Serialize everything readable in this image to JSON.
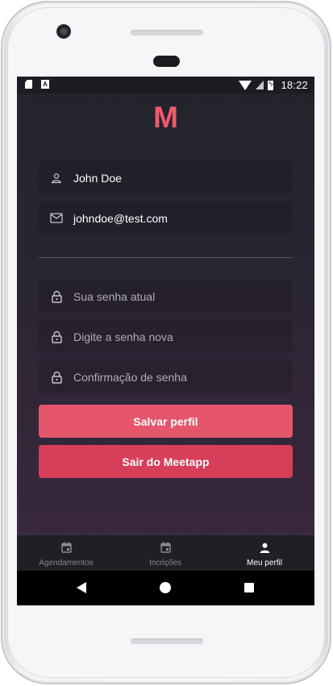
{
  "status_bar": {
    "time": "18:22",
    "notif_letter": "A"
  },
  "app": {
    "logo": "M",
    "brand_color": "#f15a6d"
  },
  "profile_form": {
    "name": {
      "value": "John Doe",
      "icon": "user-icon"
    },
    "email": {
      "value": "johndoe@test.com",
      "icon": "mail-icon"
    },
    "old_password": {
      "placeholder": "Sua senha atual",
      "icon": "lock-icon"
    },
    "new_password": {
      "placeholder": "Digite a senha nova",
      "icon": "lock-icon"
    },
    "confirm_password": {
      "placeholder": "Confirmação de senha",
      "icon": "lock-icon"
    }
  },
  "buttons": {
    "save": {
      "label": "Salvar perfil",
      "color": "#e5566c"
    },
    "logout": {
      "label": "Sair do Meetapp",
      "color": "#d73e5a"
    }
  },
  "tabs": [
    {
      "label": "Agendamentos",
      "icon": "calendar-icon",
      "active": false
    },
    {
      "label": "Incrições",
      "icon": "calendar-icon",
      "active": false
    },
    {
      "label": "Meu perfil",
      "icon": "person-icon",
      "active": true
    }
  ]
}
